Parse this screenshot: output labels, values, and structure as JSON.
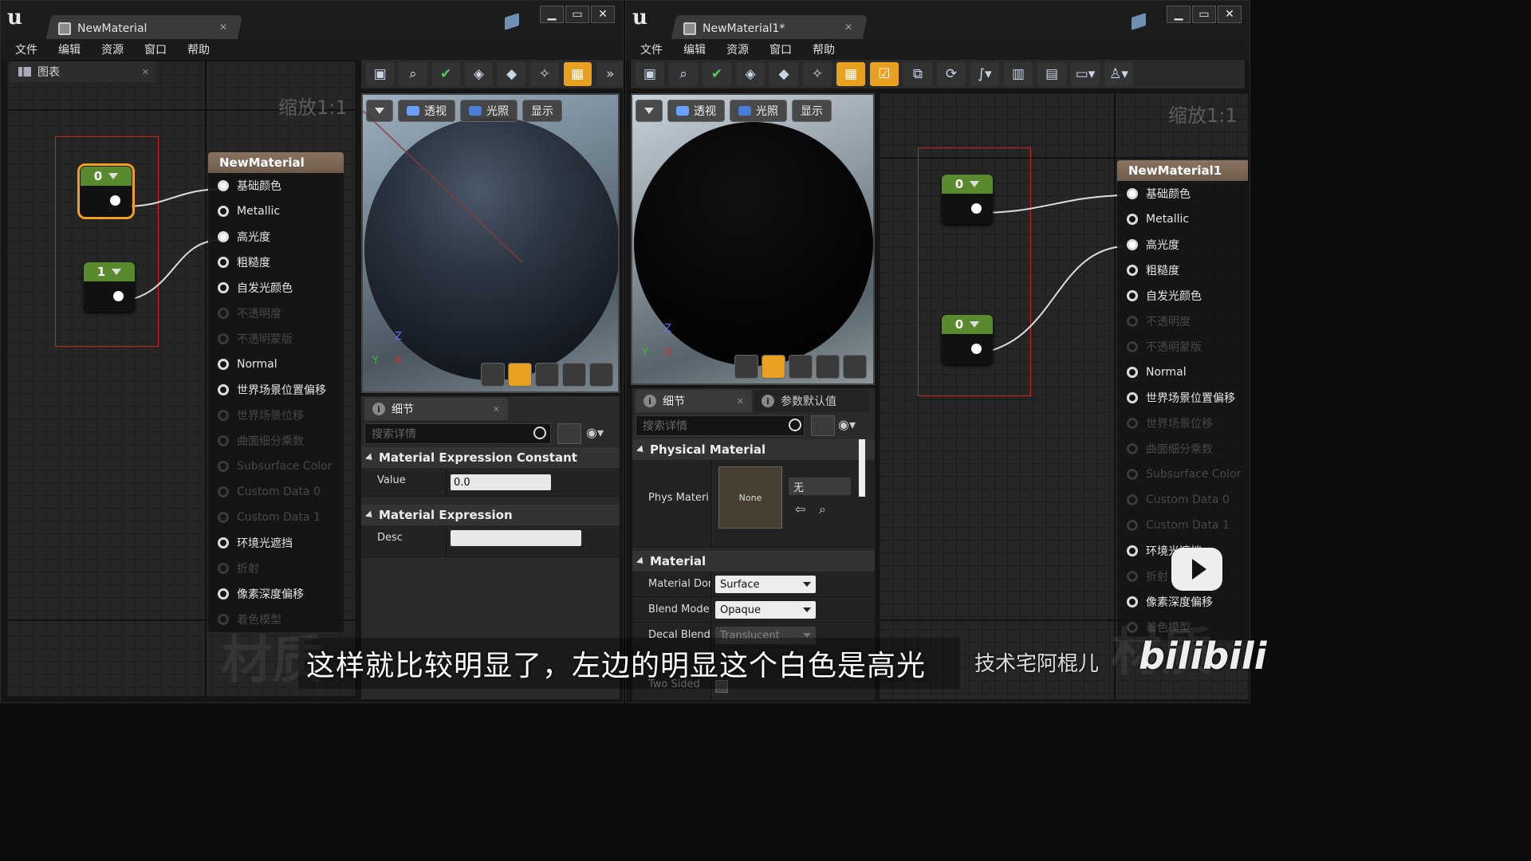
{
  "left_window": {
    "tab_title": "NewMaterial",
    "menu": [
      "文件",
      "编辑",
      "资源",
      "窗口",
      "帮助"
    ],
    "graph_tab": "图表",
    "zoom": "缩放1:1",
    "constants": [
      {
        "value": "0"
      },
      {
        "value": "1"
      }
    ],
    "node": {
      "title": "NewMaterial",
      "pins": [
        {
          "label": "基础颜色"
        },
        {
          "label": "Metallic"
        },
        {
          "label": "高光度"
        },
        {
          "label": "粗糙度"
        },
        {
          "label": "自发光颜色"
        },
        {
          "label": "不透明度"
        },
        {
          "label": "不透明蒙版"
        },
        {
          "label": "Normal"
        },
        {
          "label": "世界场景位置偏移"
        },
        {
          "label": "世界场景位移"
        },
        {
          "label": "曲面细分乘数"
        },
        {
          "label": "Subsurface Color"
        },
        {
          "label": "Custom Data 0"
        },
        {
          "label": "Custom Data 1"
        },
        {
          "label": "环境光遮挡"
        },
        {
          "label": "折射"
        },
        {
          "label": "像素深度偏移"
        },
        {
          "label": "着色模型"
        }
      ]
    },
    "watermark": "材质",
    "viewport": {
      "buttons": [
        "透视",
        "光照",
        "显示"
      ]
    },
    "details": {
      "tab": "细节",
      "search_placeholder": "搜索详情",
      "cat1": "Material Expression Constant",
      "value_label": "Value",
      "value": "0.0",
      "cat2": "Material Expression",
      "desc_label": "Desc"
    }
  },
  "right_window": {
    "tab_title": "NewMaterial1*",
    "menu": [
      "文件",
      "编辑",
      "资源",
      "窗口",
      "帮助"
    ],
    "zoom": "缩放1:1",
    "constants": [
      {
        "value": "0"
      },
      {
        "value": "0"
      }
    ],
    "node": {
      "title": "NewMaterial1",
      "pins": [
        {
          "label": "基础颜色"
        },
        {
          "label": "Metallic"
        },
        {
          "label": "高光度"
        },
        {
          "label": "粗糙度"
        },
        {
          "label": "自发光颜色"
        },
        {
          "label": "不透明度"
        },
        {
          "label": "不透明蒙版"
        },
        {
          "label": "Normal"
        },
        {
          "label": "世界场景位置偏移"
        },
        {
          "label": "世界场景位移"
        },
        {
          "label": "曲面细分乘数"
        },
        {
          "label": "Subsurface Color"
        },
        {
          "label": "Custom Data 0"
        },
        {
          "label": "Custom Data 1"
        },
        {
          "label": "环境光遮挡"
        },
        {
          "label": "折射"
        },
        {
          "label": "像素深度偏移"
        },
        {
          "label": "着色模型"
        }
      ]
    },
    "watermark": "材质",
    "viewport": {
      "buttons": [
        "透视",
        "光照",
        "显示"
      ]
    },
    "details": {
      "tab": "细节",
      "tab2": "参数默认值",
      "search_placeholder": "搜索详情",
      "cat1": "Physical Material",
      "phys_label": "Phys Materi",
      "thumb": "None",
      "phys_value": "无",
      "cat2": "Material",
      "domain_label": "Material Don",
      "domain_value": "Surface",
      "blend_label": "Blend Mode",
      "blend_value": "Opaque",
      "decal_label": "Decal Blend",
      "decal_value": "Translucent",
      "two_sided_label": "Two Sided"
    }
  },
  "overlay": {
    "subtitle": "这样就比较明显了，左边的明显这个白色是高光",
    "channel": "技术宅阿棍儿",
    "logo": "bilibili"
  }
}
